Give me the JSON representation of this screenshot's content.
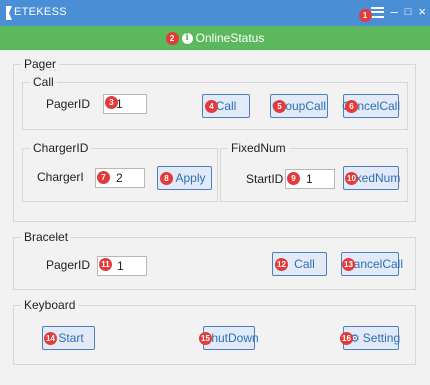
{
  "window": {
    "title": "ETEKESS",
    "controls": {
      "minimize": "–",
      "maximize": "□",
      "close": "×"
    }
  },
  "status": {
    "icon": "info-icon",
    "icon_glyph": "i",
    "text": "OnlineStatus",
    "color": "#5cb85c"
  },
  "pager": {
    "title": "Pager",
    "call": {
      "title": "Call",
      "pager_id_label": "PagerID",
      "pager_id_value": "1",
      "call_label": "Call",
      "group_call_label": "GroupCall",
      "cancel_call_label": "CancelCall"
    },
    "charger": {
      "title": "ChargerID",
      "charger_label": "ChargerI",
      "charger_value": "2",
      "apply_label": "Apply"
    },
    "fixednum": {
      "title": "FixedNum",
      "start_id_label": "StartID",
      "start_id_value": "1",
      "fixed_num_label": "FixedNum"
    }
  },
  "bracelet": {
    "title": "Bracelet",
    "pager_id_label": "PagerID",
    "pager_id_value": "1",
    "call_label": "Call",
    "cancel_call_label": "CancelCall"
  },
  "keyboard": {
    "title": "Keyboard",
    "start_label": "Start",
    "shutdown_label": "ShutDown",
    "setting_label": "Setting",
    "setting_icon": "gear-icon"
  },
  "badges": [
    "1",
    "2",
    "3",
    "4",
    "5",
    "6",
    "7",
    "8",
    "9",
    "10",
    "11",
    "12",
    "13",
    "14",
    "15",
    "16"
  ],
  "colors": {
    "titlebar": "#4a8fd6",
    "statusbar": "#5cb85c",
    "badge": "#e23b3b",
    "button_text": "#2f6fb5"
  }
}
